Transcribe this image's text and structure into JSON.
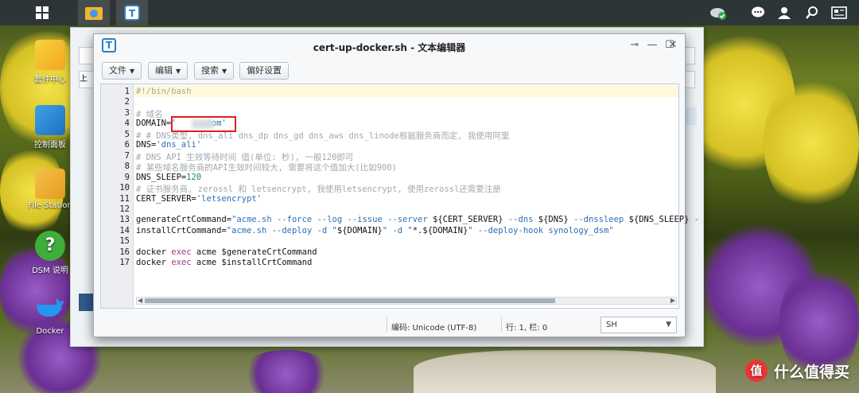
{
  "desktop": {
    "icons": [
      {
        "label": "套件中心",
        "icon": "package-center-icon"
      },
      {
        "label": "控制面板",
        "icon": "control-panel-icon"
      },
      {
        "label": "File Station",
        "icon": "file-station-icon"
      },
      {
        "label": "DSM 说明",
        "icon": "help-icon"
      },
      {
        "label": "Docker",
        "icon": "docker-icon"
      }
    ],
    "watermark": "什么值得买",
    "watermark_logo": "值"
  },
  "taskbar": {
    "icons": [
      "main-menu-icon",
      "file-station-icon",
      "text-editor-icon",
      "cloud-sync-icon",
      "chat-icon",
      "user-icon",
      "search-icon",
      "widgets-icon"
    ]
  },
  "background_window": {
    "label_1": "上"
  },
  "editor": {
    "title": "cert-up-docker.sh - 文本编辑器",
    "app_icon_glyph": "T",
    "controls": {
      "pin": "⊸",
      "minimize": "—",
      "maximize": "☐",
      "close": "✕"
    },
    "menu": {
      "file": "文件",
      "edit": "编辑",
      "search": "搜索",
      "preferences": "偏好设置"
    },
    "code_lines": [
      {
        "num": "1",
        "segments": [
          {
            "t": "#!/bin/bash",
            "c": "c"
          }
        ]
      },
      {
        "num": "2",
        "segments": []
      },
      {
        "num": "3",
        "segments": [
          {
            "t": "# 域名",
            "c": "c"
          }
        ]
      },
      {
        "num": "4",
        "segments": [
          {
            "t": "DOMAIN=",
            "c": ""
          },
          {
            "t": "'     .com'",
            "c": "s"
          }
        ]
      },
      {
        "num": "5",
        "segments": [
          {
            "t": "# # DNS类型, dns_ali dns_dp dns_gd dns_aws dns_linode根据服务商而定, 我使用阿里",
            "c": "c"
          }
        ]
      },
      {
        "num": "6",
        "segments": [
          {
            "t": "DNS=",
            "c": ""
          },
          {
            "t": "'dns_ali'",
            "c": "s"
          }
        ]
      },
      {
        "num": "7",
        "segments": [
          {
            "t": "# DNS API 生效等待时间 值(单位: 秒), 一般120即可",
            "c": "c"
          }
        ]
      },
      {
        "num": "8",
        "segments": [
          {
            "t": "# 某些域名服务商的API生效时间较大, 需要将这个值加大(比如900)",
            "c": "c"
          }
        ]
      },
      {
        "num": "9",
        "segments": [
          {
            "t": "DNS_SLEEP=",
            "c": ""
          },
          {
            "t": "120",
            "c": "n"
          }
        ]
      },
      {
        "num": "10",
        "segments": [
          {
            "t": "# 证书服务商, zerossl 和 letsencrypt, 我使用letsencrypt, 使用zerossl还需要注册",
            "c": "c"
          }
        ]
      },
      {
        "num": "11",
        "segments": [
          {
            "t": "CERT_SERVER=",
            "c": ""
          },
          {
            "t": "'letsencrypt'",
            "c": "s"
          }
        ]
      },
      {
        "num": "12",
        "segments": []
      },
      {
        "num": "13",
        "segments": [
          {
            "t": "generateCrtCommand=",
            "c": ""
          },
          {
            "t": "\"acme.sh --force --log --issue --server ",
            "c": "s"
          },
          {
            "t": "${CERT_SERVER}",
            "c": ""
          },
          {
            "t": " --dns ",
            "c": "s"
          },
          {
            "t": "${DNS}",
            "c": ""
          },
          {
            "t": " --dnssleep ",
            "c": "s"
          },
          {
            "t": "${DNS_SLEEP}",
            "c": ""
          },
          {
            "t": " -",
            "c": "s"
          }
        ]
      },
      {
        "num": "14",
        "segments": [
          {
            "t": "installCrtCommand=",
            "c": ""
          },
          {
            "t": "\"acme.sh --deploy -d \"",
            "c": "s"
          },
          {
            "t": "${DOMAIN}",
            "c": ""
          },
          {
            "t": "\" -d \"",
            "c": "s"
          },
          {
            "t": "*.",
            "c": ""
          },
          {
            "t": "${DOMAIN}",
            "c": ""
          },
          {
            "t": "\" --deploy-hook synology_dsm\"",
            "c": "s"
          }
        ]
      },
      {
        "num": "15",
        "segments": []
      },
      {
        "num": "16",
        "segments": [
          {
            "t": "docker ",
            "c": ""
          },
          {
            "t": "exec",
            "c": "k"
          },
          {
            "t": " acme ",
            "c": ""
          },
          {
            "t": "$generateCrtCommand",
            "c": ""
          }
        ]
      },
      {
        "num": "17",
        "segments": [
          {
            "t": "docker ",
            "c": ""
          },
          {
            "t": "exec",
            "c": "k"
          },
          {
            "t": " acme ",
            "c": ""
          },
          {
            "t": "$installCrtCommand",
            "c": ""
          }
        ]
      }
    ],
    "status": {
      "encoding": "编码: Unicode (UTF-8)",
      "position": "行: 1, 栏: 0",
      "language": "SH"
    },
    "scroll_position": 0.0
  }
}
